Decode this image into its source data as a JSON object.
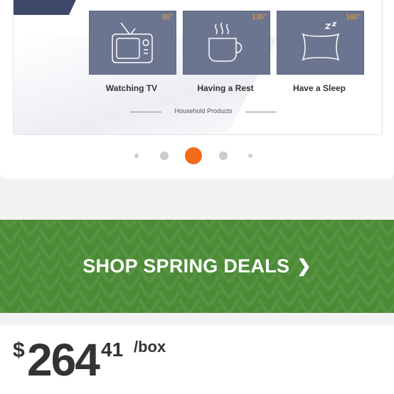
{
  "product_gallery": {
    "scenes": [
      {
        "label": "Watching TV",
        "temperature": "95°",
        "icon": "tv-icon"
      },
      {
        "label": "Having a Rest",
        "temperature": "135°",
        "icon": "coffee-cup-icon"
      },
      {
        "label": "Have a Sleep",
        "temperature": "160°",
        "icon": "pillow-sleep-icon"
      }
    ],
    "footer_label": "Household Products",
    "carousel": {
      "slide_count": 5,
      "active_index": 2
    }
  },
  "promo_banner": {
    "label": "SHOP SPRING DEALS",
    "chevron": "❯",
    "background_color": "#4b8b35"
  },
  "price": {
    "currency": "$",
    "whole": "264",
    "cents": "41",
    "unit": "/box"
  }
}
